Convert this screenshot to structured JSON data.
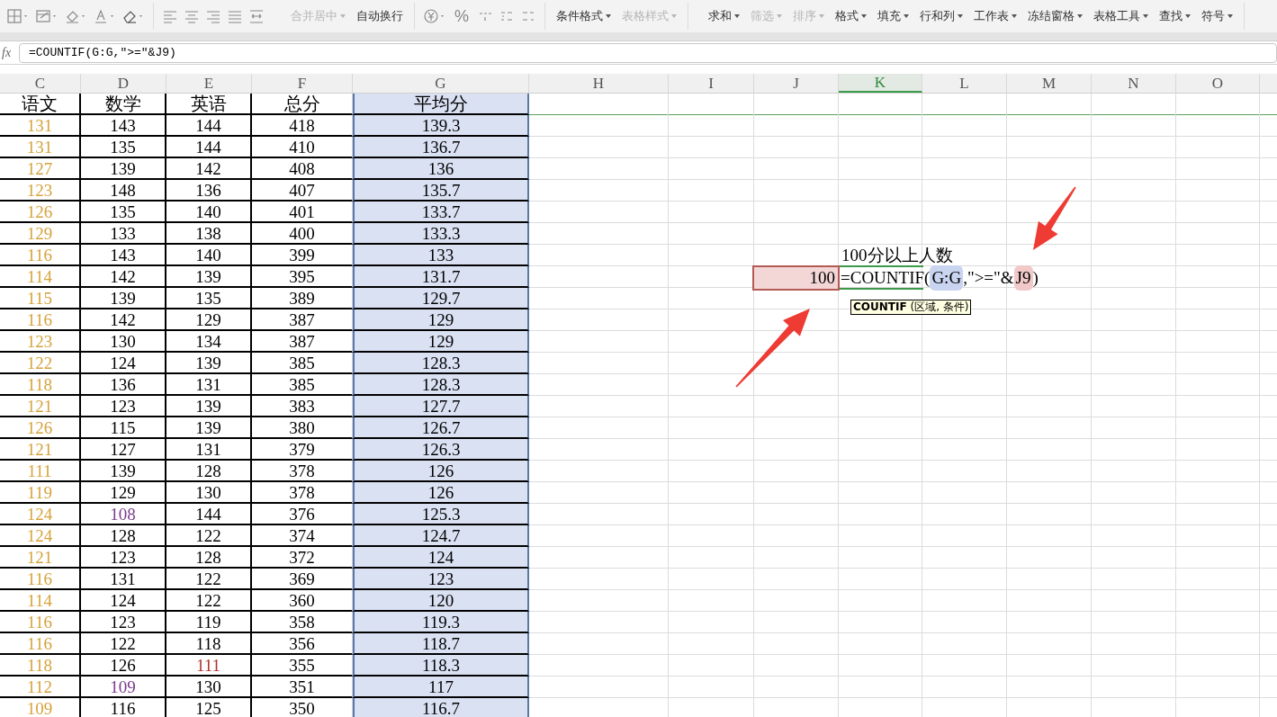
{
  "toolbar": {
    "align_buttons": [
      {
        "label": "合并居中",
        "disabled": true,
        "dropdown": true
      },
      {
        "label": "自动换行",
        "disabled": false,
        "dropdown": false
      }
    ],
    "number_buttons": [
      {
        "label": "%"
      }
    ],
    "style_buttons": [
      {
        "label": "条件格式",
        "disabled": false,
        "dropdown": true
      },
      {
        "label": "表格样式",
        "disabled": true,
        "dropdown": true
      }
    ],
    "data_buttons": [
      {
        "label": "求和",
        "disabled": false,
        "dropdown": true
      },
      {
        "label": "筛选",
        "disabled": true,
        "dropdown": true
      },
      {
        "label": "排序",
        "disabled": true,
        "dropdown": true
      },
      {
        "label": "格式",
        "disabled": false,
        "dropdown": true
      },
      {
        "label": "填充",
        "disabled": false,
        "dropdown": true
      },
      {
        "label": "行和列",
        "disabled": false,
        "dropdown": true
      },
      {
        "label": "工作表",
        "disabled": false,
        "dropdown": true
      },
      {
        "label": "冻结窗格",
        "disabled": false,
        "dropdown": true
      },
      {
        "label": "表格工具",
        "disabled": false,
        "dropdown": true
      },
      {
        "label": "查找",
        "disabled": false,
        "dropdown": true
      },
      {
        "label": "符号",
        "disabled": false,
        "dropdown": true
      }
    ]
  },
  "formula_bar": {
    "label": "fx",
    "value": "=COUNTIF(G:G,\">=\"&J9)"
  },
  "columns": [
    {
      "label": "C",
      "selected": false,
      "color": "#d6a23a"
    },
    {
      "label": "D",
      "selected": false
    },
    {
      "label": "E",
      "selected": false
    },
    {
      "label": "F",
      "selected": false
    },
    {
      "label": "G",
      "selected": false
    },
    {
      "label": "H",
      "selected": false
    },
    {
      "label": "I",
      "selected": false
    },
    {
      "label": "J",
      "selected": false
    },
    {
      "label": "K",
      "selected": true
    },
    {
      "label": "L",
      "selected": false
    },
    {
      "label": "M",
      "selected": false
    },
    {
      "label": "N",
      "selected": false
    },
    {
      "label": "O",
      "selected": false
    }
  ],
  "header_row": [
    "语文",
    "数学",
    "英语",
    "总分",
    "平均分"
  ],
  "rows": [
    [
      "131",
      "143",
      "144",
      "418",
      "139.3"
    ],
    [
      "131",
      "135",
      "144",
      "410",
      "136.7"
    ],
    [
      "127",
      "139",
      "142",
      "408",
      "136"
    ],
    [
      "123",
      "148",
      "136",
      "407",
      "135.7"
    ],
    [
      "126",
      "135",
      "140",
      "401",
      "133.7"
    ],
    [
      "129",
      "133",
      "138",
      "400",
      "133.3"
    ],
    [
      "116",
      "143",
      "140",
      "399",
      "133"
    ],
    [
      "114",
      "142",
      "139",
      "395",
      "131.7"
    ],
    [
      "115",
      "139",
      "135",
      "389",
      "129.7"
    ],
    [
      "116",
      "142",
      "129",
      "387",
      "129"
    ],
    [
      "123",
      "130",
      "134",
      "387",
      "129"
    ],
    [
      "122",
      "124",
      "139",
      "385",
      "128.3"
    ],
    [
      "118",
      "136",
      "131",
      "385",
      "128.3"
    ],
    [
      "121",
      "123",
      "139",
      "383",
      "127.7"
    ],
    [
      "126",
      "115",
      "139",
      "380",
      "126.7"
    ],
    [
      "121",
      "127",
      "131",
      "379",
      "126.3"
    ],
    [
      "111",
      "139",
      "128",
      "378",
      "126"
    ],
    [
      "119",
      "129",
      "130",
      "378",
      "126"
    ],
    [
      "124",
      {
        "text": "108",
        "color": "#7a3a8c"
      },
      "144",
      "376",
      "125.3"
    ],
    [
      "124",
      "128",
      "122",
      "374",
      "124.7"
    ],
    [
      "121",
      "123",
      "128",
      "372",
      "124"
    ],
    [
      "116",
      "131",
      "122",
      "369",
      "123"
    ],
    [
      "114",
      "124",
      "122",
      "360",
      "120"
    ],
    [
      "116",
      "123",
      "119",
      "358",
      "119.3"
    ],
    [
      "116",
      "122",
      "118",
      "356",
      "118.7"
    ],
    [
      "118",
      "126",
      {
        "text": "111",
        "color": "#b0302a"
      },
      "355",
      "118.3"
    ],
    [
      "112",
      {
        "text": "109",
        "color": "#7a3a8c"
      },
      "130",
      "351",
      "117"
    ],
    [
      "109",
      "116",
      "125",
      "350",
      "116.7"
    ]
  ],
  "side_label": "100分以上人数",
  "input_cell": "100",
  "editor_parts": [
    {
      "text": "=COUNTIF(",
      "kind": "text"
    },
    {
      "text": "G:G",
      "kind": "ref",
      "color": "#c9d4f0"
    },
    {
      "text": ",\">=\"&",
      "kind": "text"
    },
    {
      "text": "J9",
      "kind": "ref",
      "color": "#f2c9c9"
    },
    {
      "text": ")",
      "kind": "text"
    }
  ],
  "tooltip": "**COUNTIF** (区域, 条件)"
}
